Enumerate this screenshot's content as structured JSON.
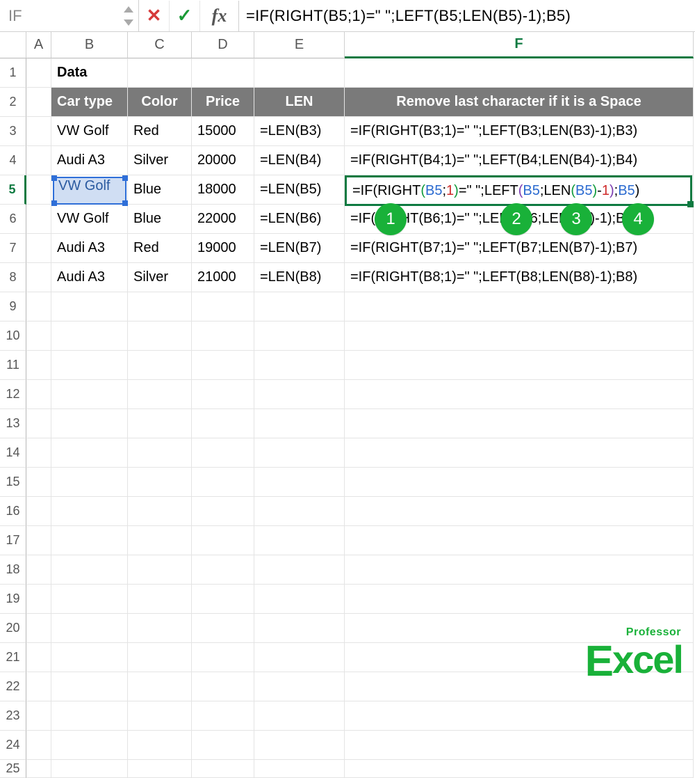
{
  "formula_bar": {
    "name_box": "IF",
    "cancel_icon": "✕",
    "accept_icon": "✓",
    "fx_label": "fx",
    "formula": "=IF(RIGHT(B5;1)=\" \";LEFT(B5;LEN(B5)-1);B5)"
  },
  "columns": {
    "A": "A",
    "B": "B",
    "C": "C",
    "D": "D",
    "E": "E",
    "F": "F"
  },
  "rows": [
    "1",
    "2",
    "3",
    "4",
    "5",
    "6",
    "7",
    "8",
    "9",
    "10",
    "11",
    "12",
    "13",
    "14",
    "15",
    "16",
    "17",
    "18",
    "19",
    "20",
    "21",
    "22",
    "23",
    "24",
    "25"
  ],
  "section_title": "Data",
  "headers": {
    "car_type": "Car type",
    "color": "Color",
    "price": "Price",
    "len": "LEN",
    "remove": "Remove last character if it is a Space"
  },
  "data_rows": [
    {
      "car": "VW Golf",
      "color": "Red",
      "price": "15000",
      "len": "=LEN(B3)",
      "f": "=IF(RIGHT(B3;1)=\" \";LEFT(B3;LEN(B3)-1);B3)"
    },
    {
      "car": "Audi A3",
      "color": "Silver",
      "price": "20000",
      "len": "=LEN(B4)",
      "f": "=IF(RIGHT(B4;1)=\" \";LEFT(B4;LEN(B4)-1);B4)"
    },
    {
      "car": "VW Golf",
      "color": "Blue",
      "price": "18000",
      "len": "=LEN(B5)",
      "f": "=IF(RIGHT(B5;1)=\" \";LEFT(B5;LEN(B5)-1);B5)"
    },
    {
      "car": "VW Golf",
      "color": "Blue",
      "price": "22000",
      "len": "=LEN(B6)",
      "f": "=IF(RIGHT(B6;1)=\" \";LEFT(B6;LEN(B6)-1);B6)"
    },
    {
      "car": "Audi A3",
      "color": "Red",
      "price": "19000",
      "len": "=LEN(B7)",
      "f": "=IF(RIGHT(B7;1)=\" \";LEFT(B7;LEN(B7)-1);B7)"
    },
    {
      "car": "Audi A3",
      "color": "Silver",
      "price": "21000",
      "len": "=LEN(B8)",
      "f": "=IF(RIGHT(B8;1)=\" \";LEFT(B8;LEN(B8)-1);B8)"
    }
  ],
  "active_edit": {
    "row_index": 5,
    "parts": {
      "p1": "=IF(RIGHT",
      "open1": "(",
      "ref1": "B5",
      "sep1": ";",
      "one": "1",
      "close1": ")",
      "eq": "=\" \";LEFT",
      "open2": "(",
      "ref2": "B5",
      "sep2": ";LEN",
      "open3": "(",
      "ref3": "B5",
      "close3": ")",
      "minus": "-",
      "oneB": "1",
      "close2": ")",
      "sep3": ";",
      "ref4": "B5",
      "close4": ")"
    }
  },
  "callouts": [
    "1",
    "2",
    "3",
    "4"
  ],
  "watermark": {
    "small": "Professor",
    "big": "Excel"
  }
}
